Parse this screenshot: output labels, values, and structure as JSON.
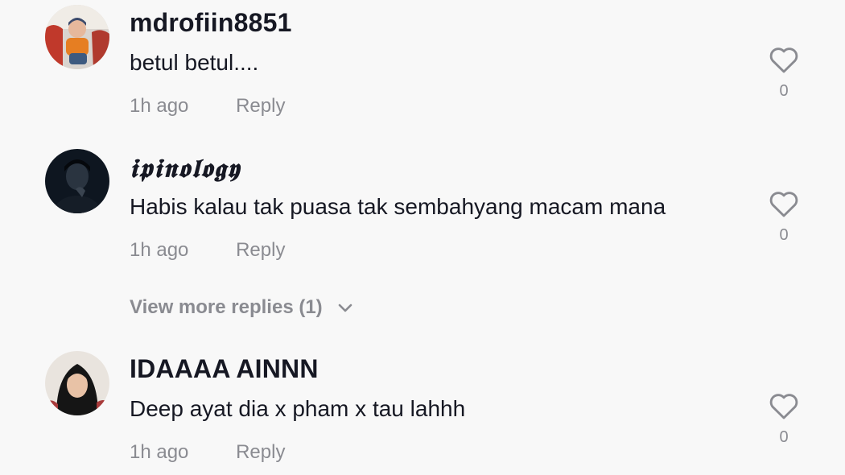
{
  "comments": [
    {
      "username": "mdrofiin8851",
      "text": "betul betul....",
      "time": "1h ago",
      "reply_label": "Reply",
      "likes": "0",
      "avatar": "avatar-child-photo"
    },
    {
      "username": "𝖎𝖕𝖎𝖓𝖔𝖑𝖔𝖌𝖞",
      "text": "Habis kalau tak puasa tak sembahyang macam mana",
      "time": "1h ago",
      "reply_label": "Reply",
      "likes": "0",
      "avatar": "avatar-dark-portrait"
    },
    {
      "username": "IDAAAA AINNN",
      "text": "Deep ayat dia x pham x tau lahhh",
      "time": "1h ago",
      "reply_label": "Reply",
      "likes": "0",
      "avatar": "avatar-woman-hijab"
    }
  ],
  "view_more_replies": "View more replies (1)",
  "colors": {
    "background": "#f8f8f8",
    "primary_text": "#161823",
    "secondary_text": "#8a8b91"
  }
}
